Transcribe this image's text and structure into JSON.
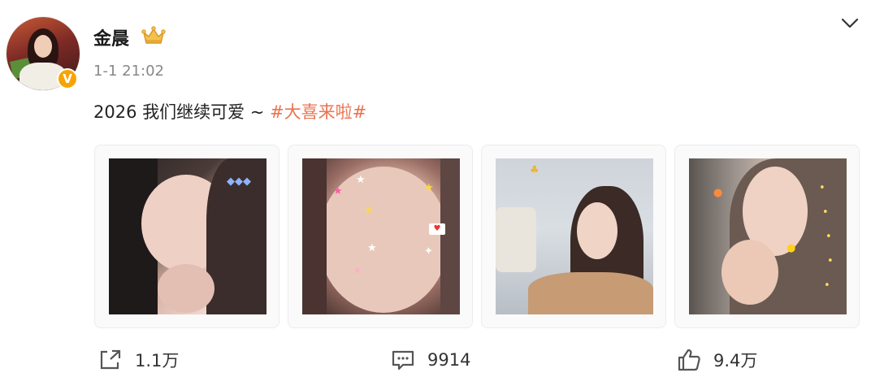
{
  "user": {
    "name": "金晨",
    "time": "1-1 21:02",
    "verified_mark": "V"
  },
  "post": {
    "text": "2026 我们继续可爱 ~ ",
    "hashtag": "#大喜来啦#"
  },
  "photos": [
    {
      "label": "selfie-1"
    },
    {
      "label": "selfie-2"
    },
    {
      "label": "selfie-3"
    },
    {
      "label": "selfie-4"
    }
  ],
  "actions": {
    "share_count": "1.1万",
    "comment_count": "9914",
    "like_count": "9.4万"
  },
  "colors": {
    "hashtag": "#eb7350",
    "verified": "#f7a400",
    "muted": "#888888"
  },
  "icons": [
    "share-icon",
    "comment-icon",
    "like-icon",
    "chevron-down-icon",
    "crown-icon",
    "verified-icon"
  ]
}
